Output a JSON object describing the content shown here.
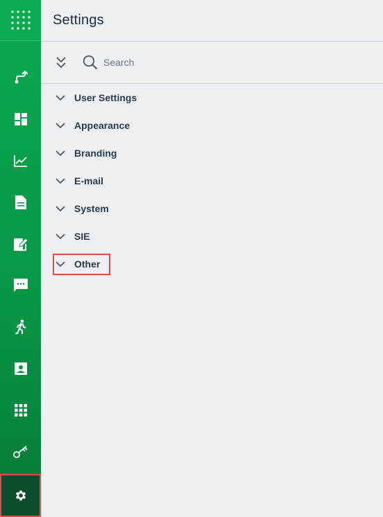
{
  "header": {
    "title": "Settings"
  },
  "toolbar": {
    "search_placeholder": "Search"
  },
  "sections": [
    {
      "label": "User Settings"
    },
    {
      "label": "Appearance"
    },
    {
      "label": "Branding"
    },
    {
      "label": "E-mail"
    },
    {
      "label": "System"
    },
    {
      "label": "SIE"
    },
    {
      "label": "Other"
    }
  ],
  "sidebar": {
    "icons": [
      "apps-grid-icon",
      "route-icon",
      "dashboard-icon",
      "analytics-icon",
      "document-icon",
      "edit-document-icon",
      "chat-icon",
      "run-icon",
      "contact-card-icon",
      "grid-icon",
      "key-icon",
      "gear-icon"
    ]
  },
  "colors": {
    "sidebar_green": "#079845",
    "active_dark": "#0c4d2b",
    "highlight_red": "#e24b4b",
    "background": "#edf0f3"
  }
}
